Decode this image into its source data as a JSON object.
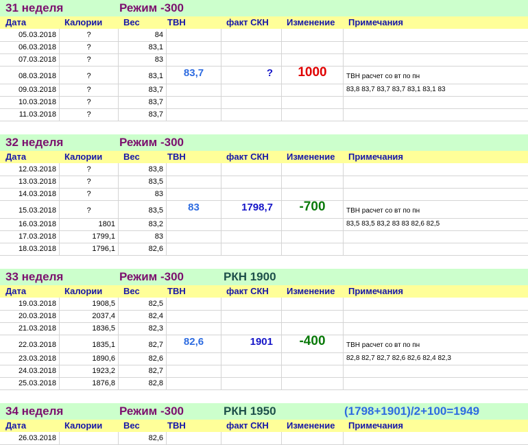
{
  "headers": [
    "Дата",
    "Калории",
    "Вес",
    "ТВН",
    "факт СКН",
    "Изменение",
    "Примечания"
  ],
  "weeks": [
    {
      "title": "31 неделя",
      "mode": "Режим -300",
      "rkn": "",
      "formula": "",
      "days": [
        {
          "date": "05.03.2018",
          "cal": "?",
          "weight": "84"
        },
        {
          "date": "06.03.2018",
          "cal": "?",
          "weight": "83,1"
        },
        {
          "date": "07.03.2018",
          "cal": "?",
          "weight": "83"
        },
        {
          "date": "08.03.2018",
          "cal": "?",
          "weight": "83,1"
        },
        {
          "date": "09.03.2018",
          "cal": "?",
          "weight": "83,7"
        },
        {
          "date": "10.03.2018",
          "cal": "?",
          "weight": "83,7"
        },
        {
          "date": "11.03.2018",
          "cal": "?",
          "weight": "83,7"
        }
      ],
      "tvn": "83,7",
      "skn": "?",
      "change": "1000",
      "change_color": "red",
      "note1": "ТВН расчет со вт по пн",
      "note2": "83,8  83,7  83,7  83,7  83,1  83,1  83"
    },
    {
      "title": "32  неделя",
      "mode": "Режим -300",
      "rkn": "",
      "formula": "",
      "days": [
        {
          "date": "12.03.2018",
          "cal": "?",
          "weight": "83,8"
        },
        {
          "date": "13.03.2018",
          "cal": "?",
          "weight": "83,5"
        },
        {
          "date": "14.03.2018",
          "cal": "?",
          "weight": "83"
        },
        {
          "date": "15.03.2018",
          "cal": "?",
          "weight": "83,5"
        },
        {
          "date": "16.03.2018",
          "cal": "1801",
          "weight": "83,2"
        },
        {
          "date": "17.03.2018",
          "cal": "1799,1",
          "weight": "83"
        },
        {
          "date": "18.03.2018",
          "cal": "1796,1",
          "weight": "82,6"
        }
      ],
      "tvn": "83",
      "skn": "1798,7",
      "change": "-700",
      "change_color": "green",
      "note1": "ТВН расчет со вт по пн",
      "note2": "83,5  83,5  83,2  83  83  82,6  82,5"
    },
    {
      "title": "33  неделя",
      "mode": "Режим -300",
      "rkn": "РКН 1900",
      "formula": "",
      "days": [
        {
          "date": "19.03.2018",
          "cal": "1908,5",
          "weight": "82,5"
        },
        {
          "date": "20.03.2018",
          "cal": "2037,4",
          "weight": "82,4"
        },
        {
          "date": "21.03.2018",
          "cal": "1836,5",
          "weight": "82,3"
        },
        {
          "date": "22.03.2018",
          "cal": "1835,1",
          "weight": "82,7"
        },
        {
          "date": "23.03.2018",
          "cal": "1890,6",
          "weight": "82,6"
        },
        {
          "date": "24.03.2018",
          "cal": "1923,2",
          "weight": "82,7"
        },
        {
          "date": "25.03.2018",
          "cal": "1876,8",
          "weight": "82,8"
        }
      ],
      "tvn": "82,6",
      "skn": "1901",
      "change": "-400",
      "change_color": "green",
      "note1": "ТВН расчет со вт по пн",
      "note2": "82,8  82,7  82,7  82,6  82,6  82,4  82,3"
    },
    {
      "title": "34  неделя",
      "mode": "Режим -300",
      "rkn": "РКН 1950",
      "formula": "(1798+1901)/2+100=1949",
      "days": [
        {
          "date": "26.03.2018",
          "cal": "",
          "weight": "82,6"
        }
      ],
      "tvn": "",
      "skn": "",
      "change": "",
      "change_color": "green",
      "note1": "",
      "note2": ""
    }
  ]
}
